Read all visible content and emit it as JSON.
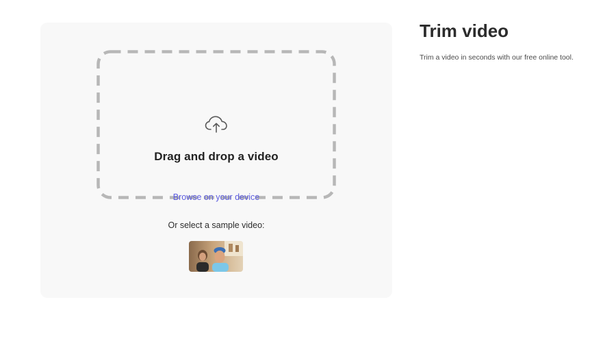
{
  "upload": {
    "drop_title": "Drag and drop a video",
    "browse_label": "Browse on your device",
    "sample_label": "Or select a sample video:",
    "upload_icon": "cloud-upload-icon",
    "link_color": "#5c5ce0",
    "dash_color": "#b7b7b7"
  },
  "info": {
    "title": "Trim video",
    "description": "Trim a video in seconds with our free online tool."
  }
}
